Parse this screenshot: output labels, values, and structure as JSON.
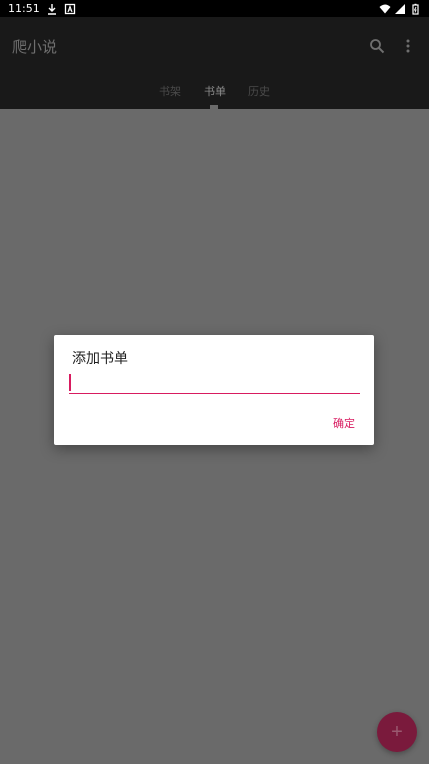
{
  "status_bar": {
    "time": "11:51",
    "icons": [
      "download-icon",
      "a-badge-icon",
      "wifi-icon",
      "signal-icon",
      "battery-icon"
    ]
  },
  "app_bar": {
    "title": "爬小说",
    "actions": [
      "search-icon",
      "more-vert-icon"
    ]
  },
  "tabs": [
    {
      "label": "书架",
      "active": false
    },
    {
      "label": "书单",
      "active": true
    },
    {
      "label": "历史",
      "active": false
    }
  ],
  "dialog": {
    "title": "添加书单",
    "input_value": "",
    "input_placeholder": "",
    "ok_label": "确定"
  },
  "fab": {
    "icon": "plus-icon",
    "label": "+"
  },
  "colors": {
    "accent": "#d81b60",
    "scrim": "#6a6a6a",
    "app_bar": "#191919"
  }
}
